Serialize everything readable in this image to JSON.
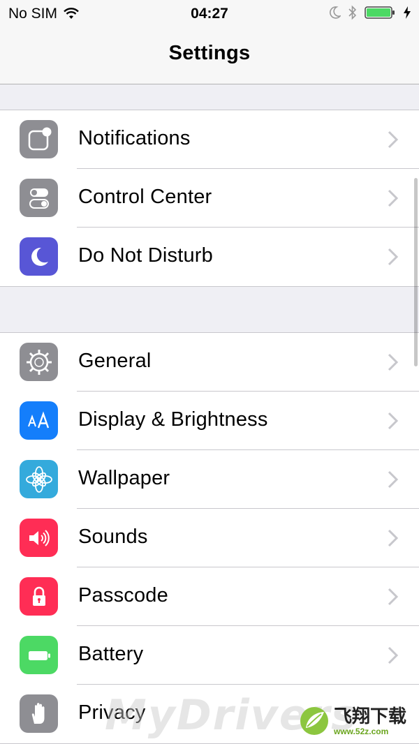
{
  "status_bar": {
    "carrier": "No SIM",
    "time": "04:27"
  },
  "nav": {
    "title": "Settings"
  },
  "groups": [
    {
      "items": [
        {
          "label": "Notifications",
          "icon": "notifications-icon",
          "color": "#8e8e93"
        },
        {
          "label": "Control Center",
          "icon": "control-center-icon",
          "color": "#8e8e93"
        },
        {
          "label": "Do Not Disturb",
          "icon": "moon-icon",
          "color": "#5856d6"
        }
      ]
    },
    {
      "items": [
        {
          "label": "General",
          "icon": "gear-icon",
          "color": "#8e8e93"
        },
        {
          "label": "Display & Brightness",
          "icon": "text-size-icon",
          "color": "#147efb"
        },
        {
          "label": "Wallpaper",
          "icon": "flower-icon",
          "color": "#34aadc"
        },
        {
          "label": "Sounds",
          "icon": "speaker-icon",
          "color": "#ff2d55"
        },
        {
          "label": "Passcode",
          "icon": "lock-icon",
          "color": "#ff2d55"
        },
        {
          "label": "Battery",
          "icon": "battery-icon",
          "color": "#4cd964"
        },
        {
          "label": "Privacy",
          "icon": "hand-icon",
          "color": "#8e8e93"
        }
      ]
    }
  ],
  "watermark": {
    "text": "MyDrivers",
    "logo_cn": "飞翔下载",
    "logo_url": "www.52z.com"
  }
}
